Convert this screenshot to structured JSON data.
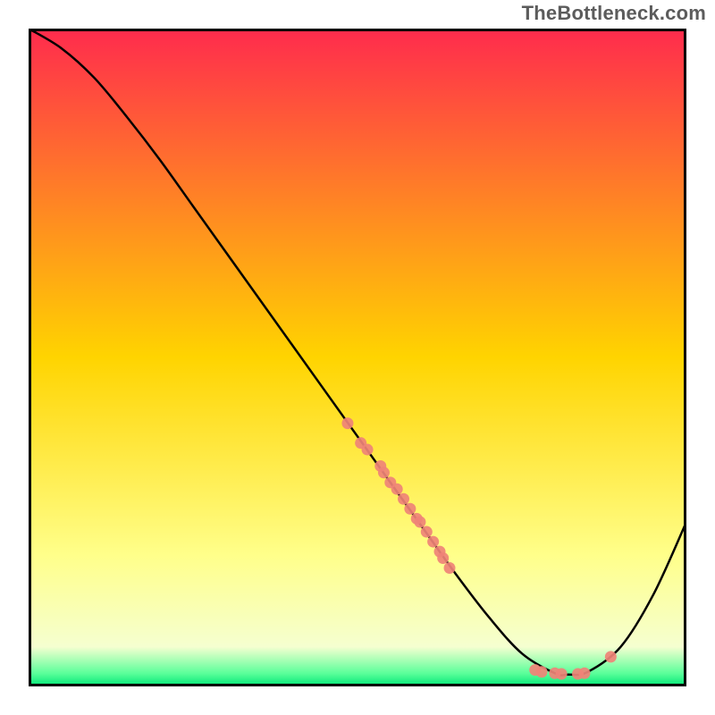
{
  "watermark": "TheBottleneck.com",
  "chart_data": {
    "type": "line",
    "title": "",
    "xlabel": "",
    "ylabel": "",
    "xlim": [
      0,
      100
    ],
    "ylim": [
      0,
      100
    ],
    "background_gradient": {
      "stops": [
        {
          "offset": 0.0,
          "color": "#ff2b4d"
        },
        {
          "offset": 0.5,
          "color": "#ffd400"
        },
        {
          "offset": 0.8,
          "color": "#ffff8a"
        },
        {
          "offset": 0.94,
          "color": "#f5ffd0"
        },
        {
          "offset": 0.98,
          "color": "#5bff9a"
        },
        {
          "offset": 1.0,
          "color": "#00e676"
        }
      ]
    },
    "series": [
      {
        "name": "curve",
        "type": "line",
        "color": "#000000",
        "x": [
          0,
          5,
          10,
          15,
          20,
          25,
          30,
          35,
          40,
          45,
          50,
          55,
          60,
          65,
          70,
          75,
          80,
          82,
          85,
          90,
          95,
          100
        ],
        "y": [
          100,
          97,
          92.5,
          86.5,
          80,
          73,
          66,
          59,
          52,
          45,
          38,
          31,
          24,
          17,
          10.5,
          5,
          2,
          1.8,
          2.2,
          6,
          14,
          25
        ]
      },
      {
        "name": "markers",
        "type": "scatter",
        "color": "#ef8377",
        "points": [
          {
            "x": 48.5,
            "y": 40
          },
          {
            "x": 50.5,
            "y": 37
          },
          {
            "x": 51.5,
            "y": 36
          },
          {
            "x": 53.5,
            "y": 33.5
          },
          {
            "x": 54.0,
            "y": 32.5
          },
          {
            "x": 55.0,
            "y": 31
          },
          {
            "x": 56.0,
            "y": 30
          },
          {
            "x": 57.0,
            "y": 28.5
          },
          {
            "x": 58.0,
            "y": 27
          },
          {
            "x": 59.0,
            "y": 25.5
          },
          {
            "x": 59.5,
            "y": 25
          },
          {
            "x": 60.5,
            "y": 23.5
          },
          {
            "x": 61.5,
            "y": 22
          },
          {
            "x": 62.5,
            "y": 20.5
          },
          {
            "x": 63.0,
            "y": 19.5
          },
          {
            "x": 64.0,
            "y": 18
          },
          {
            "x": 77.0,
            "y": 2.5
          },
          {
            "x": 78.0,
            "y": 2.2
          },
          {
            "x": 80.0,
            "y": 2.0
          },
          {
            "x": 81.0,
            "y": 1.9
          },
          {
            "x": 83.5,
            "y": 1.9
          },
          {
            "x": 84.5,
            "y": 2.0
          },
          {
            "x": 88.5,
            "y": 4.5
          }
        ]
      }
    ],
    "axes_visible": false,
    "grid": false,
    "border": {
      "width": 3,
      "color": "#000000"
    }
  }
}
